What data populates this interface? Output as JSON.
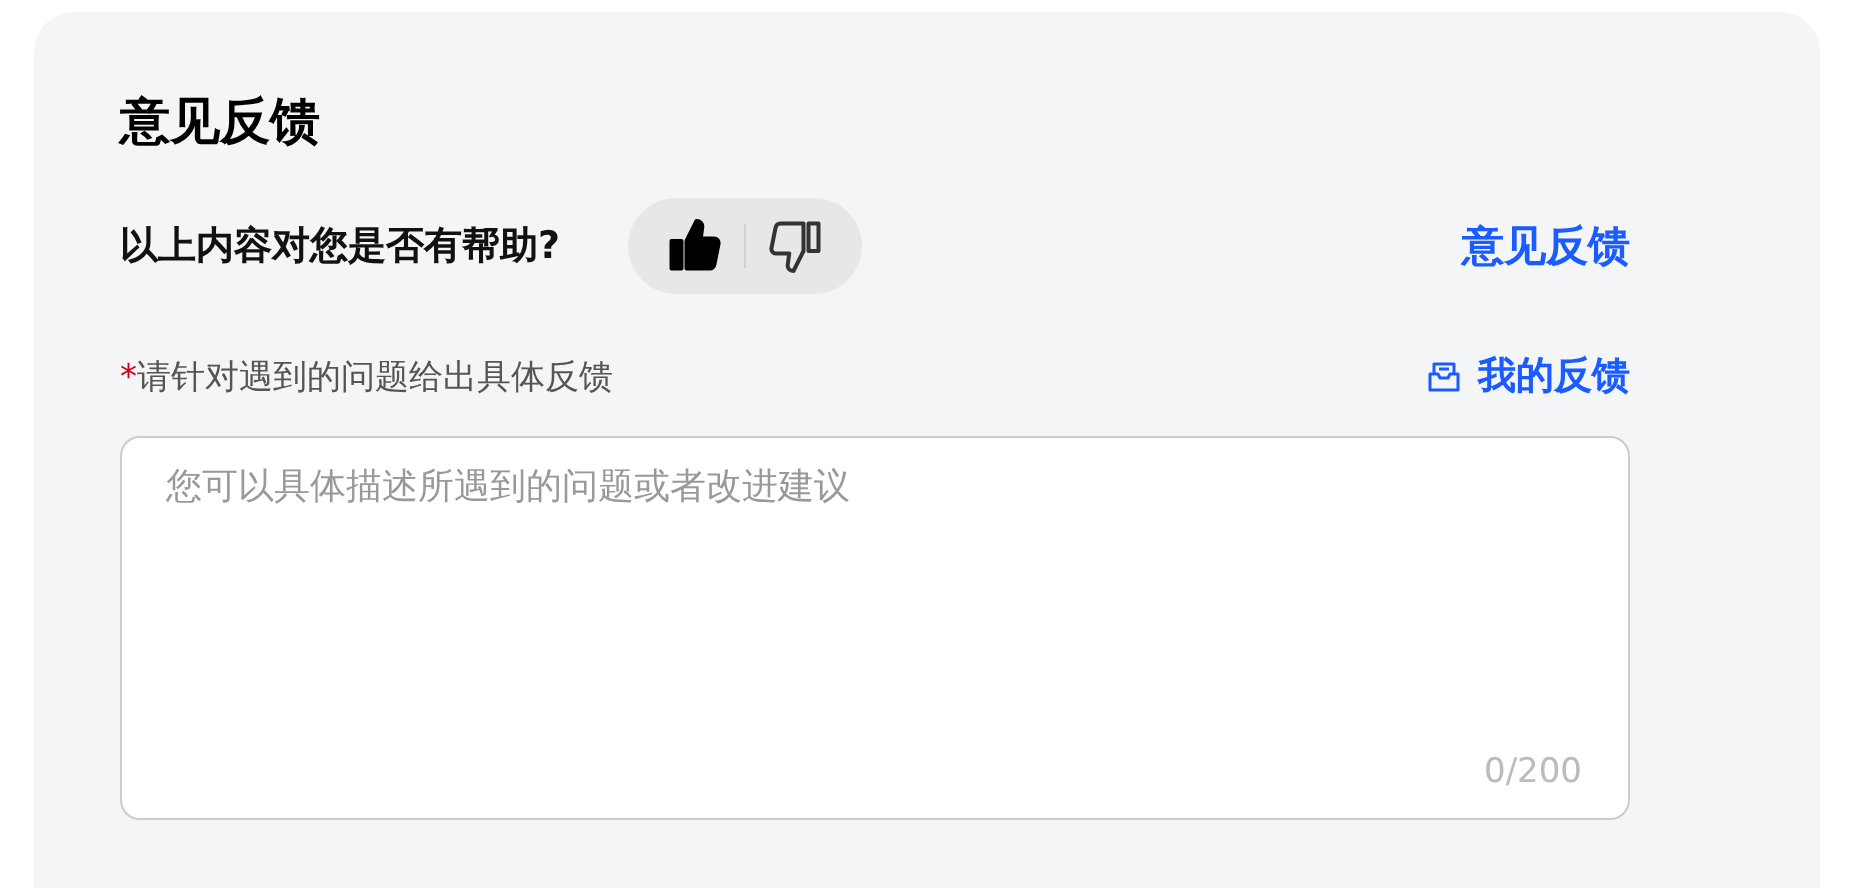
{
  "title": "意见反馈",
  "helpful": {
    "question": "以上内容对您是否有帮助?",
    "votes": [
      {
        "kind": "up",
        "selected": true
      },
      {
        "kind": "down",
        "selected": false
      }
    ],
    "link": "意见反馈"
  },
  "feedback": {
    "required_mark": "*",
    "label": "请针对遇到的问题给出具体反馈",
    "my_feedback": "我的反馈",
    "placeholder": "您可以具体描述所遇到的问题或者改进建议",
    "counter": "0/200"
  }
}
